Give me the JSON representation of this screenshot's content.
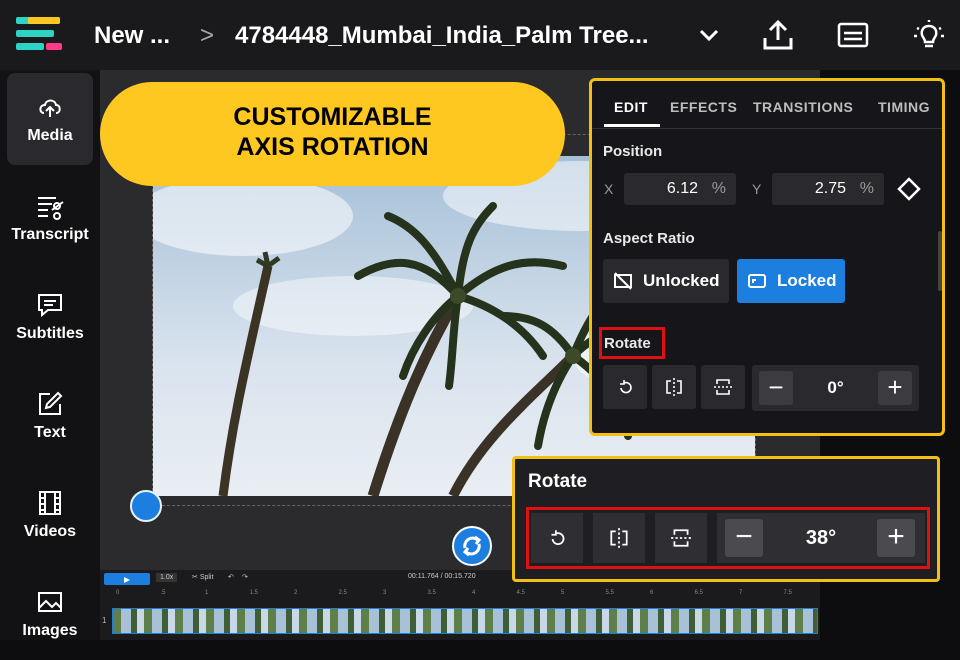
{
  "topbar": {
    "project_name": "New ...",
    "breadcrumb_sep": ">",
    "file_name": "4784448_Mumbai_India_Palm Tree...",
    "icons": [
      "logo-icon",
      "chevron-down-icon",
      "upload-icon",
      "subtitles-icon",
      "lightbulb-icon"
    ]
  },
  "sidebar": {
    "items": [
      {
        "label": "Media",
        "icon": "media-upload-icon",
        "active": true
      },
      {
        "label": "Transcript",
        "icon": "transcript-icon"
      },
      {
        "label": "Subtitles",
        "icon": "subtitles-icon"
      },
      {
        "label": "Text",
        "icon": "text-edit-icon"
      },
      {
        "label": "Videos",
        "icon": "film-icon"
      },
      {
        "label": "Images",
        "icon": "image-icon"
      }
    ]
  },
  "callout": {
    "line1": "CUSTOMIZABLE",
    "line2": "AXIS ROTATION"
  },
  "timeline": {
    "zoom": "1.0x",
    "split": "Split",
    "time": "00:11.764 / 00:15.720",
    "track_number": "1",
    "ruler": [
      "0",
      ".5",
      "1",
      "1.5",
      "2",
      "2.5",
      "3",
      "3.5",
      "4",
      "4.5",
      "5",
      "5.5",
      "6",
      "6.5",
      "7",
      "7.5"
    ]
  },
  "panel": {
    "tabs": [
      "EDIT",
      "EFFECTS",
      "TRANSITIONS",
      "TIMING"
    ],
    "active_tab": "EDIT",
    "position_label": "Position",
    "x_label": "X",
    "x_value": "6.12",
    "y_label": "Y",
    "y_value": "2.75",
    "unit": "%",
    "aspect_label": "Aspect Ratio",
    "unlocked_label": "Unlocked",
    "locked_label": "Locked",
    "rotate_label": "Rotate",
    "rotation_value": "0°",
    "accent": "#1c7fe0"
  },
  "zoom_panel": {
    "title": "Rotate",
    "minus": "−",
    "plus": "+",
    "rotation_value": "38°"
  },
  "colors": {
    "highlight_yellow": "#f2c012",
    "highlight_red": "#e01010",
    "callout_bg": "#ffc820",
    "primary_blue": "#1c7fe0"
  }
}
